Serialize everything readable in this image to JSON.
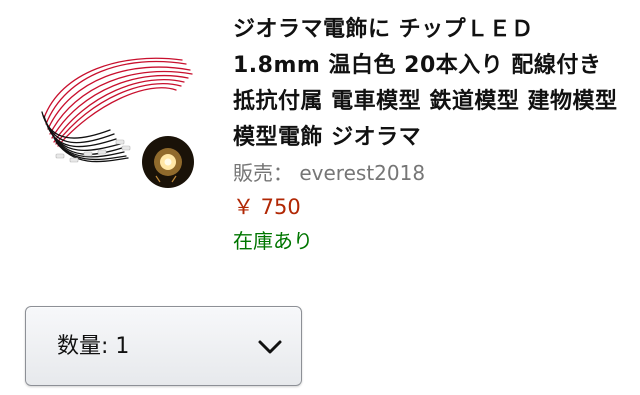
{
  "product": {
    "title": "ジオラマ電飾に チップＬＥＤ 1.8mm 温白色 20本入り 配線付き 抵抗付属 電車模型 鉄道模型 建物模型 模型電飾 ジオラマ",
    "seller_label": "販売：",
    "seller_name": "everest2018",
    "price": "￥ 750",
    "availability": "在庫あり",
    "image_icon": "led-wire-bundle-photo",
    "price_color": "#b12704",
    "availability_color": "#007600"
  },
  "quantity": {
    "label": "数量:",
    "value": "1",
    "icon": "chevron-down-icon"
  }
}
